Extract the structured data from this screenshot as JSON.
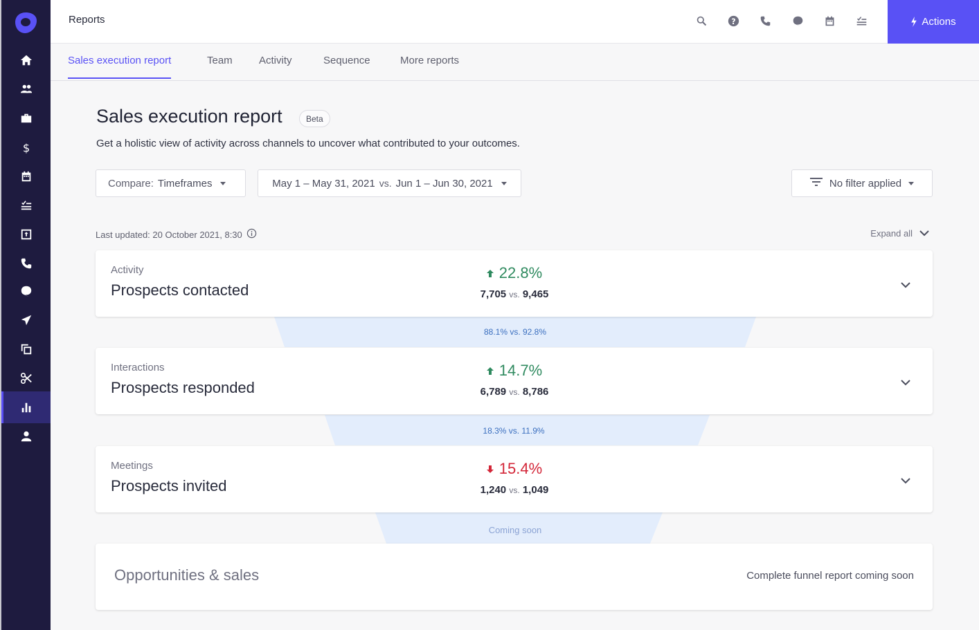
{
  "app": {
    "brand_color": "#5951f5",
    "sidebar_color": "#1e1b3f"
  },
  "sidebar": {
    "logo": "outreach-logo",
    "items": [
      {
        "icon": "home-icon",
        "label": "Home"
      },
      {
        "icon": "people-icon",
        "label": "Prospects"
      },
      {
        "icon": "briefcase-icon",
        "label": "Accounts"
      },
      {
        "icon": "dollar-icon",
        "label": "Opportunities"
      },
      {
        "icon": "calendar-icon",
        "label": "Meetings"
      },
      {
        "icon": "tasks-icon",
        "label": "Tasks"
      },
      {
        "icon": "inbox-icon",
        "label": "Inbox"
      },
      {
        "icon": "phone-icon",
        "label": "Calls"
      },
      {
        "icon": "chat-icon",
        "label": "Messages"
      },
      {
        "icon": "send-icon",
        "label": "Sequences"
      },
      {
        "icon": "copy-icon",
        "label": "Templates"
      },
      {
        "icon": "scissors-icon",
        "label": "Snippets"
      },
      {
        "icon": "bar-chart-icon",
        "label": "Reports",
        "active": true
      },
      {
        "icon": "user-icon",
        "label": "Profile"
      }
    ]
  },
  "header": {
    "title": "Reports",
    "icons": [
      "search-icon",
      "help-icon",
      "phone-icon",
      "chat-icon",
      "calendar-icon",
      "tasks-icon"
    ],
    "actions_label": "Actions"
  },
  "tabs": [
    {
      "label": "Sales execution report",
      "active": true
    },
    {
      "label": "Team"
    },
    {
      "label": "Activity"
    },
    {
      "label": "Sequence"
    },
    {
      "label": "More reports"
    }
  ],
  "page": {
    "title": "Sales execution report",
    "badge": "Beta",
    "subtitle": "Get a holistic view of activity across channels to uncover what contributed to your outcomes.",
    "compare": {
      "prefix": "Compare:",
      "value": "Timeframes"
    },
    "date_range": {
      "range_a": "May 1 – May 31, 2021",
      "vs": "vs.",
      "range_b": "Jun 1 – Jun 30, 2021"
    },
    "filter_label": "No filter applied",
    "last_updated": "Last updated: 20 October 2021, 8:30",
    "expand_all": "Expand all"
  },
  "funnel": {
    "stages": [
      {
        "category": "Activity",
        "name": "Prospects contacted",
        "direction": "up",
        "change": "22.8%",
        "value_a": "7,705",
        "vs": "vs.",
        "value_b": "9,465",
        "conversion": "88.1% vs. 92.8%"
      },
      {
        "category": "Interactions",
        "name": "Prospects responded",
        "direction": "up",
        "change": "14.7%",
        "value_a": "6,789",
        "vs": "vs.",
        "value_b": "8,786",
        "conversion": "18.3% vs. 11.9%"
      },
      {
        "category": "Meetings",
        "name": "Prospects invited",
        "direction": "down",
        "change": "15.4%",
        "value_a": "1,240",
        "vs": "vs.",
        "value_b": "1,049",
        "conversion": "Coming soon"
      }
    ],
    "final": {
      "name": "Opportunities & sales",
      "note": "Complete funnel report coming soon"
    },
    "colors": {
      "up": "#2f8a5f",
      "down": "#d32638",
      "funnel_fill": "#e3edfc",
      "conversion_text": "#3b6fbf"
    }
  }
}
